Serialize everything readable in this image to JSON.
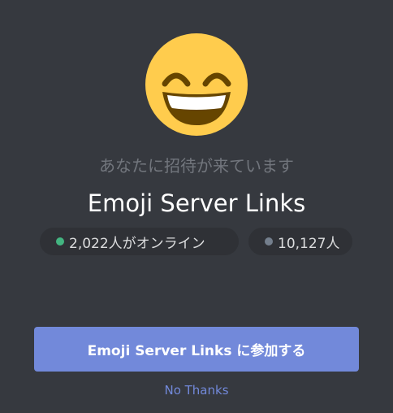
{
  "invite": {
    "subtitle": "あなたに招待が来ています",
    "server_name": "Emoji Server Links",
    "online_count": "2,022人がオンライン",
    "member_count": "10,127人",
    "join_label": "Emoji Server Links に参加する",
    "decline_label": "No Thanks",
    "icon": "grinning-face-emoji-icon"
  },
  "colors": {
    "background": "#36393f",
    "pill_background": "#2f3136",
    "online_dot": "#43b581",
    "member_dot": "#747f8d",
    "button": "#7289da",
    "link": "#7289da",
    "emoji_face": "#ffcc4d",
    "emoji_mouth": "#664500"
  }
}
